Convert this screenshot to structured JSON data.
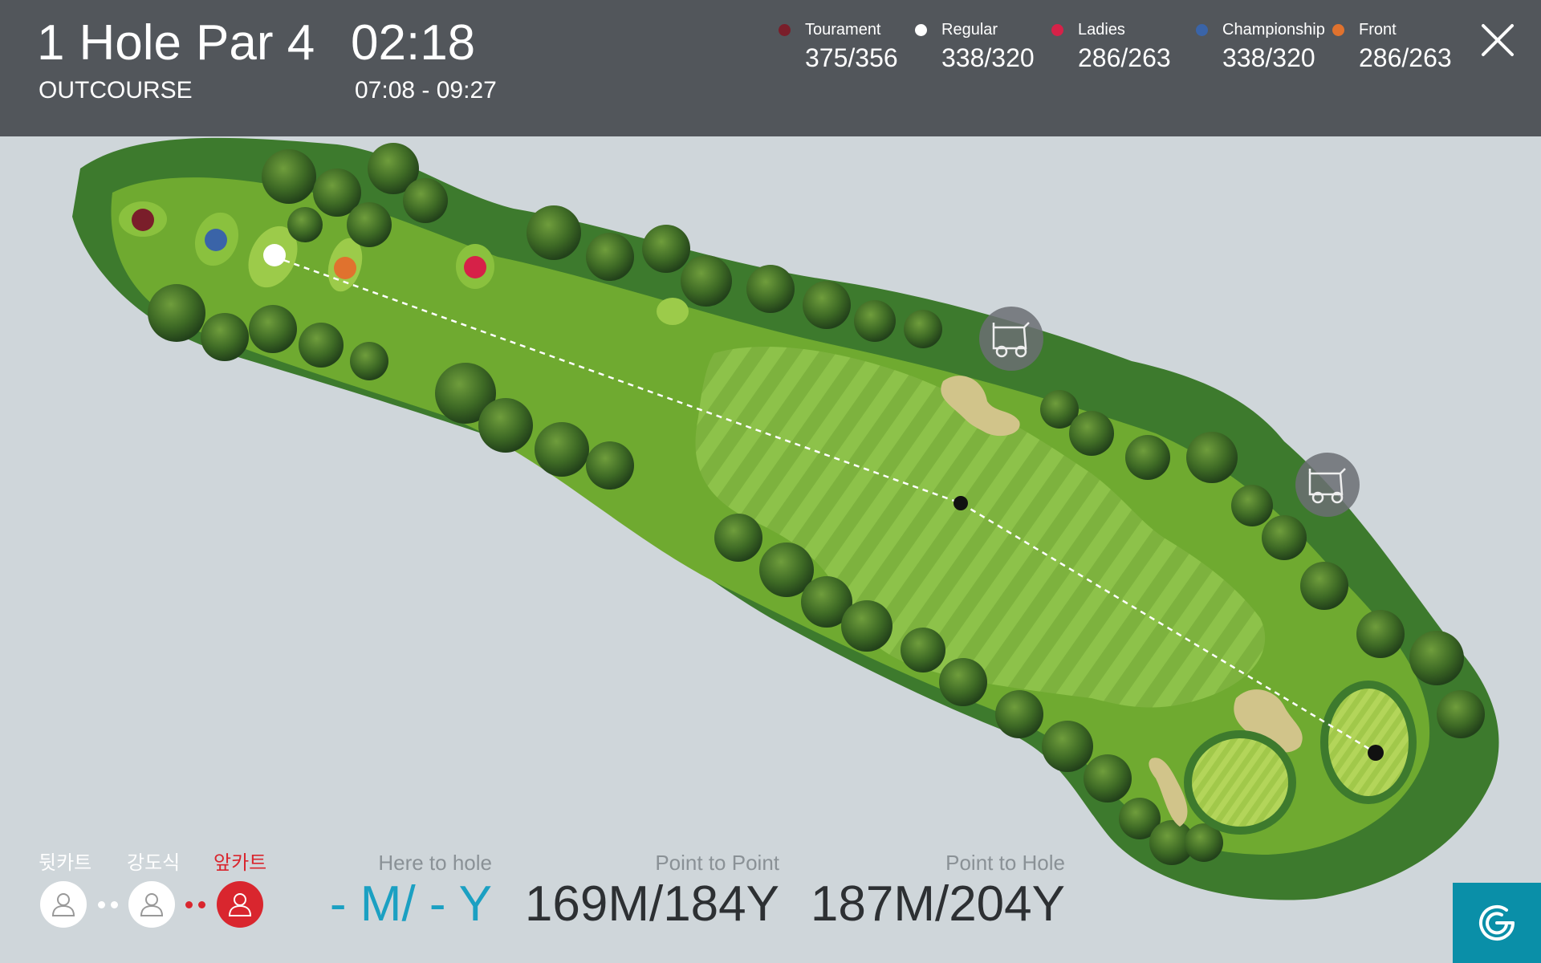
{
  "header": {
    "hole_number": "1",
    "hole_word": "Hole",
    "par": "Par 4",
    "elapsed": "02:18",
    "course": "OUTCOURSE",
    "time_range": "07:08 - 09:27"
  },
  "tees": [
    {
      "name": "Tourament",
      "value": "375/356",
      "color": "#7a1e2a"
    },
    {
      "name": "Regular",
      "value": "338/320",
      "color": "#ffffff"
    },
    {
      "name": "Ladies",
      "value": "286/263",
      "color": "#d62148"
    },
    {
      "name": "Championship",
      "value": "338/320",
      "color": "#3a64a8"
    },
    {
      "name": "Front",
      "value": "286/263",
      "color": "#e0722e"
    }
  ],
  "icons": {
    "close": "close-icon",
    "cart": "golf-cart-icon",
    "user": "user-icon",
    "logo": "app-logo-icon"
  },
  "players": [
    {
      "label": "뒷카트",
      "active": false
    },
    {
      "label": "강도식",
      "active": false
    },
    {
      "label": "앞카트",
      "active": true
    }
  ],
  "distances": {
    "here_to_hole": {
      "label": "Here to hole",
      "value": "- M/ - Y"
    },
    "point_to_point": {
      "label": "Point to Point",
      "value": "169M/184Y"
    },
    "point_to_hole": {
      "label": "Point to Hole",
      "value": "187M/204Y"
    }
  },
  "colors": {
    "header_bg": "#52565b",
    "accent_blue": "#1ba0c2",
    "active_red": "#d9262e",
    "rough": "#3b7a2c",
    "fairway": "#7fb83a",
    "green": "#a9cf4a"
  }
}
